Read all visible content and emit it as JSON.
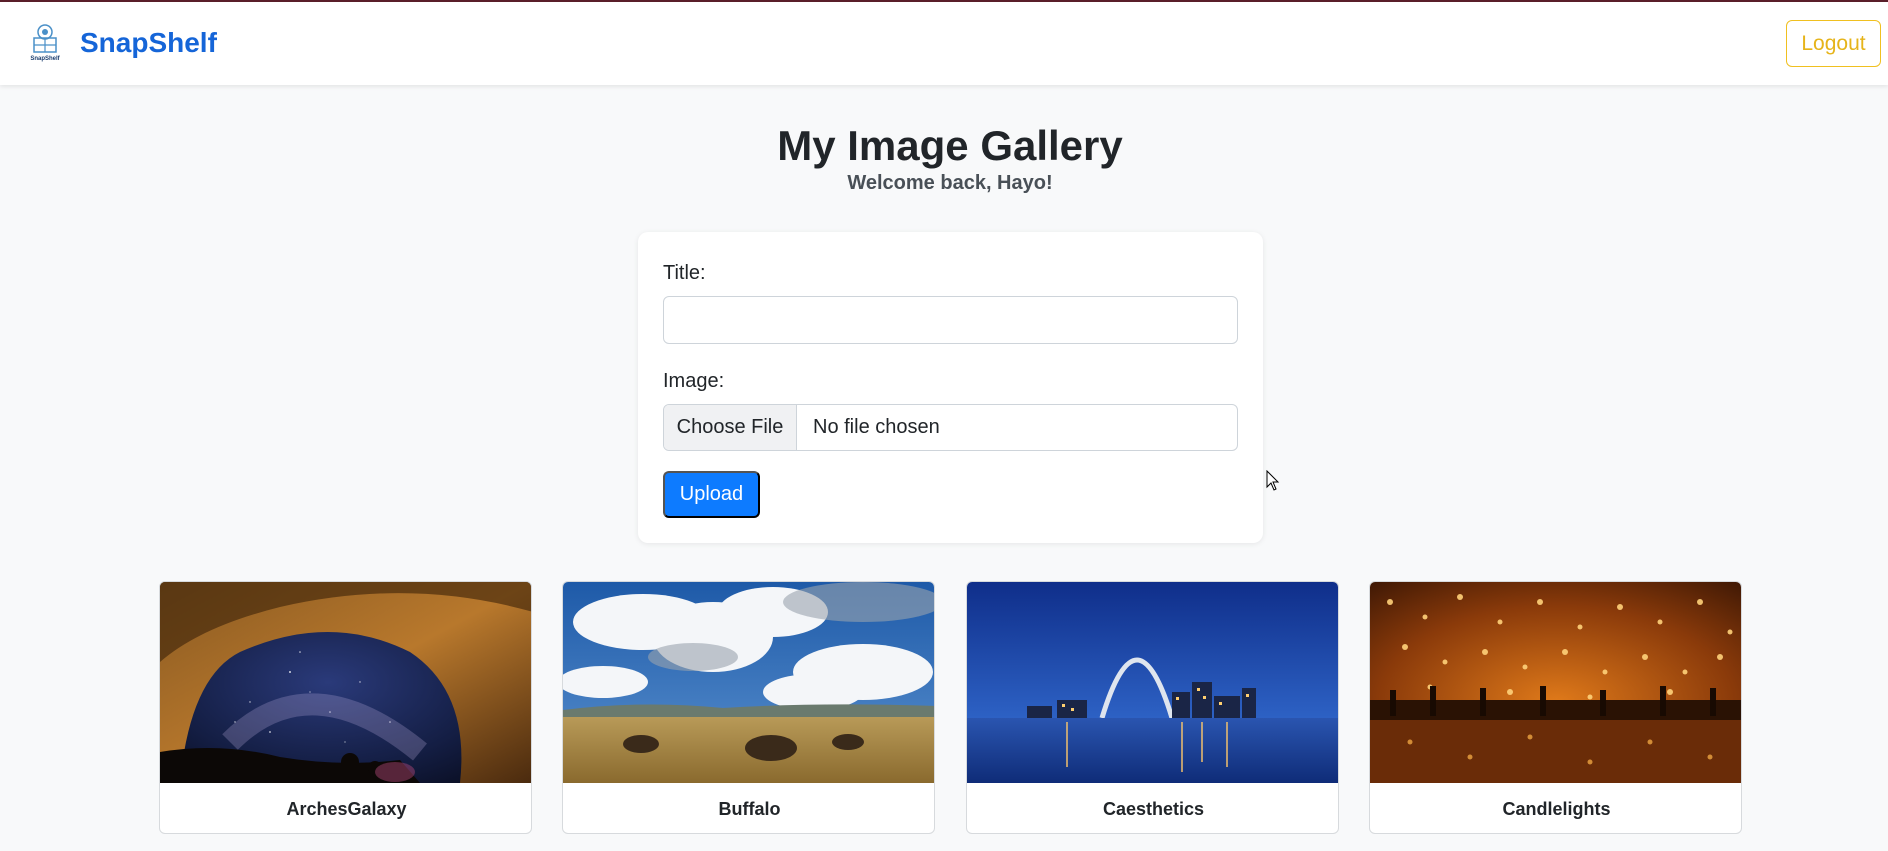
{
  "app": {
    "name": "SnapShelf",
    "logo_text": "SnapShelf"
  },
  "nav": {
    "logout_label": "Logout"
  },
  "page": {
    "title": "My Image Gallery",
    "subtitle": "Welcome back, Hayo!"
  },
  "form": {
    "title_label": "Title:",
    "title_value": "",
    "image_label": "Image:",
    "file_button_label": "Choose File",
    "file_status": "No file chosen",
    "upload_label": "Upload"
  },
  "gallery": [
    {
      "caption": "ArchesGalaxy",
      "scene": "night sky with rock arch and milky way"
    },
    {
      "caption": "Buffalo",
      "scene": "bison grazing on prairie under cloudy blue sky"
    },
    {
      "caption": "Caesthetics",
      "scene": "city skyline with gateway arch at night over river"
    },
    {
      "caption": "Candlelights",
      "scene": "floating sky lanterns reflected on water"
    }
  ],
  "colors": {
    "brand": "#1565d8",
    "logout": "#e6b41a",
    "primary": "#0d7bff",
    "background": "#f8f9fa"
  }
}
